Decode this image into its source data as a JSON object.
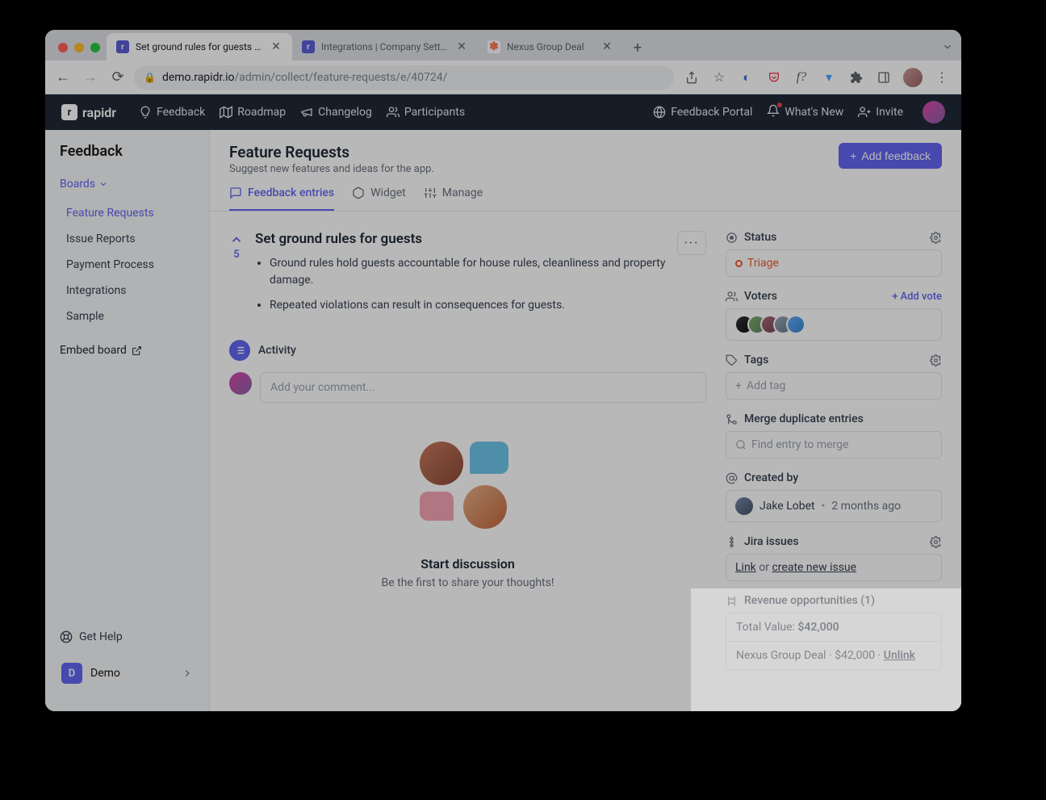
{
  "browser": {
    "tabs": [
      {
        "title": "Set ground rules for guests - R",
        "favicon_bg": "#5b5fd9",
        "favicon_text": "r"
      },
      {
        "title": "Integrations | Company Setting",
        "favicon_bg": "#5b5fd9",
        "favicon_text": "r"
      },
      {
        "title": "Nexus Group Deal",
        "favicon_bg": "#ff7a59",
        "favicon_text": ""
      }
    ],
    "url_domain": "demo.rapidr.io",
    "url_path": "/admin/collect/feature-requests/e/40724/"
  },
  "topnav": {
    "logo": "rapidr",
    "items": [
      "Feedback",
      "Roadmap",
      "Changelog",
      "Participants"
    ],
    "right": [
      "Feedback Portal",
      "What's New",
      "Invite"
    ]
  },
  "sidebar": {
    "title": "Feedback",
    "boards_label": "Boards",
    "items": [
      "Feature Requests",
      "Issue Reports",
      "Payment Process",
      "Integrations",
      "Sample"
    ],
    "embed_label": "Embed board",
    "help_label": "Get Help",
    "workspace_initial": "D",
    "workspace_name": "Demo"
  },
  "page": {
    "title": "Feature Requests",
    "subtitle": "Suggest new features and ideas for the app.",
    "add_btn": "Add feedback",
    "tabs": [
      "Feedback entries",
      "Widget",
      "Manage"
    ]
  },
  "entry": {
    "votes": "5",
    "title": "Set ground rules for guests",
    "bullets": [
      "Ground rules hold guests accountable for house rules, cleanliness and property damage.",
      "Repeated violations can result in consequences for guests."
    ]
  },
  "activity": {
    "label": "Activity",
    "comment_placeholder": "Add your comment...",
    "empty_title": "Start discussion",
    "empty_sub": "Be the first to share your thoughts!"
  },
  "side": {
    "status_label": "Status",
    "status_value": "Triage",
    "voters_label": "Voters",
    "add_vote": "Add vote",
    "tags_label": "Tags",
    "add_tag": "Add tag",
    "merge_label": "Merge duplicate entries",
    "merge_placeholder": "Find entry to merge",
    "created_label": "Created by",
    "created_name": "Jake Lobet",
    "created_time": "2 months ago",
    "jira_label": "Jira issues",
    "jira_link": "Link",
    "jira_or": " or ",
    "jira_create": "create new issue",
    "revenue_label": "Revenue opportunities (1)",
    "revenue_total_label": "Total Value: ",
    "revenue_total_value": "$42,000",
    "revenue_deal_name": "Nexus Group Deal",
    "revenue_deal_value": "$42,000",
    "revenue_unlink": "Unlink"
  }
}
